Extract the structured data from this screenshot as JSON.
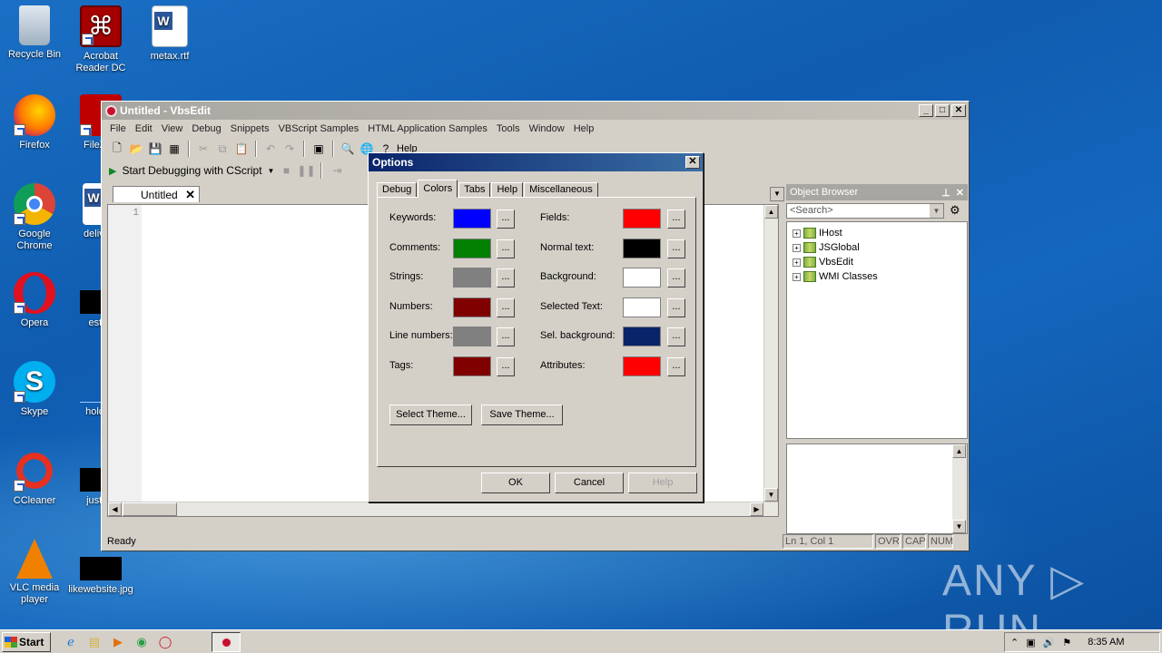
{
  "desktop": {
    "icons": [
      {
        "label": "Recycle Bin"
      },
      {
        "label": "Acrobat Reader DC"
      },
      {
        "label": "metax.rtf"
      },
      {
        "label": "Firefox"
      },
      {
        "label": "FileZilla"
      },
      {
        "label": "Google Chrome"
      },
      {
        "label": "delivery"
      },
      {
        "label": "Opera"
      },
      {
        "label": "estno"
      },
      {
        "label": "Skype"
      },
      {
        "label": "holdfro"
      },
      {
        "label": "CCleaner"
      },
      {
        "label": "justuni"
      },
      {
        "label": "VLC media player"
      },
      {
        "label": "likewebsite.jpg"
      }
    ],
    "watermark": "ANY ▷ RUN"
  },
  "window": {
    "title": "Untitled - VbsEdit",
    "menu": [
      "File",
      "Edit",
      "View",
      "Debug",
      "Snippets",
      "VBScript Samples",
      "HTML Application Samples",
      "Tools",
      "Window",
      "Help"
    ],
    "toolbar_help_label": "Help",
    "debug_start_label": "Start Debugging with CScript",
    "editor_tab": "Untitled",
    "line_number": "1",
    "status_text": "Ready",
    "status_position": "Ln 1, Col 1",
    "status_ovr": "OVR",
    "status_cap": "CAP",
    "status_num": "NUM"
  },
  "object_browser": {
    "title": "Object Browser",
    "search_placeholder": "<Search>",
    "items": [
      "IHost",
      "JSGlobal",
      "VbsEdit",
      "WMI Classes"
    ]
  },
  "dialog": {
    "title": "Options",
    "tabs": [
      "Debug",
      "Colors",
      "Tabs",
      "Help",
      "Miscellaneous"
    ],
    "active_tab": "Colors",
    "left_colors": [
      {
        "label": "Keywords:",
        "color": "#0000ff"
      },
      {
        "label": "Comments:",
        "color": "#007f00"
      },
      {
        "label": "Strings:",
        "color": "#808080"
      },
      {
        "label": "Numbers:",
        "color": "#800000"
      },
      {
        "label": "Line numbers:",
        "color": "#808080"
      },
      {
        "label": "Tags:",
        "color": "#800000"
      }
    ],
    "right_colors": [
      {
        "label": "Fields:",
        "color": "#ff0000"
      },
      {
        "label": "Normal text:",
        "color": "#000000"
      },
      {
        "label": "Background:",
        "color": "#ffffff"
      },
      {
        "label": "Selected Text:",
        "color": "#ffffff"
      },
      {
        "label": "Sel. background:",
        "color": "#0a246a"
      },
      {
        "label": "Attributes:",
        "color": "#ff0000"
      }
    ],
    "browse_label": "...",
    "select_theme": "Select Theme...",
    "save_theme": "Save Theme...",
    "ok": "OK",
    "cancel": "Cancel",
    "help": "Help"
  },
  "taskbar": {
    "start": "Start",
    "clock": "8:35 AM"
  }
}
